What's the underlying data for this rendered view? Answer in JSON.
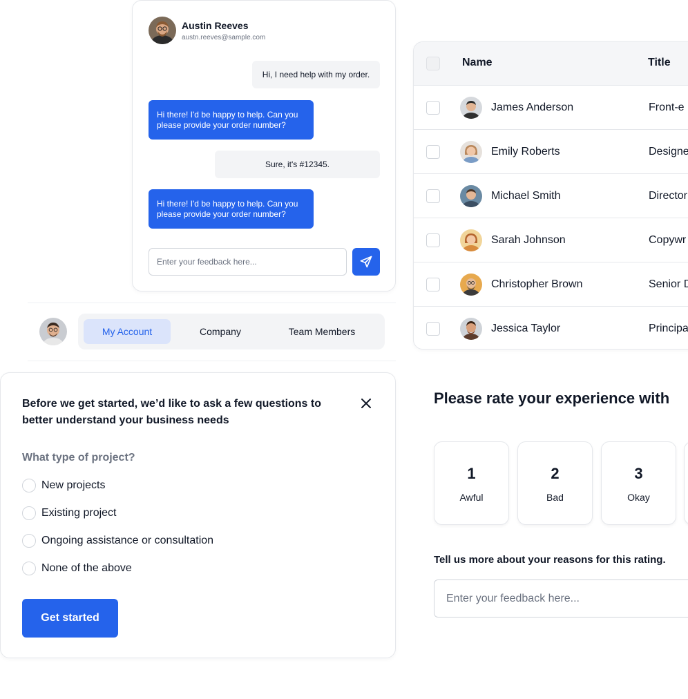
{
  "chat": {
    "user_name": "Austin Reeves",
    "user_email": "austn.reeves@sample.com",
    "messages": [
      {
        "from": "user",
        "text": "Hi, I need help with my order."
      },
      {
        "from": "agent",
        "text": "Hi there! I'd be happy to help. Can you please provide your order number?"
      },
      {
        "from": "user",
        "text": "Sure, it's #12345."
      },
      {
        "from": "agent",
        "text": "Hi there! I'd be happy to help. Can you please provide your order number?"
      }
    ],
    "input_placeholder": "Enter your feedback here...",
    "send_icon": "paper-plane-icon"
  },
  "tabs": {
    "items": [
      "My Account",
      "Company",
      "Team Members"
    ],
    "active": "My Account"
  },
  "table": {
    "columns": [
      "Name",
      "Title"
    ],
    "rows": [
      {
        "name": "James Anderson",
        "title": "Front-e"
      },
      {
        "name": "Emily Roberts",
        "title": "Designe"
      },
      {
        "name": "Michael Smith",
        "title": "Director"
      },
      {
        "name": "Sarah Johnson",
        "title": "Copywr"
      },
      {
        "name": "Christopher Brown",
        "title": "Senior D"
      },
      {
        "name": "Jessica Taylor",
        "title": "Principa"
      }
    ]
  },
  "survey": {
    "title": "Before we get started, we’d like to ask a few questions to better understand your business needs",
    "question": "What type of project?",
    "options": [
      "New projects",
      "Existing project",
      "Ongoing assistance or consultation",
      "None of the above"
    ],
    "button": "Get started",
    "close_icon": "close-icon"
  },
  "rating": {
    "title": "Please rate your experience with",
    "options": [
      {
        "value": "1",
        "label": "Awful"
      },
      {
        "value": "2",
        "label": "Bad"
      },
      {
        "value": "3",
        "label": "Okay"
      }
    ],
    "reason_label": "Tell us more about your reasons for this rating.",
    "reason_placeholder": "Enter your feedback here..."
  },
  "colors": {
    "accent": "#2563eb",
    "tab_active_bg": "#dbe4fb"
  }
}
